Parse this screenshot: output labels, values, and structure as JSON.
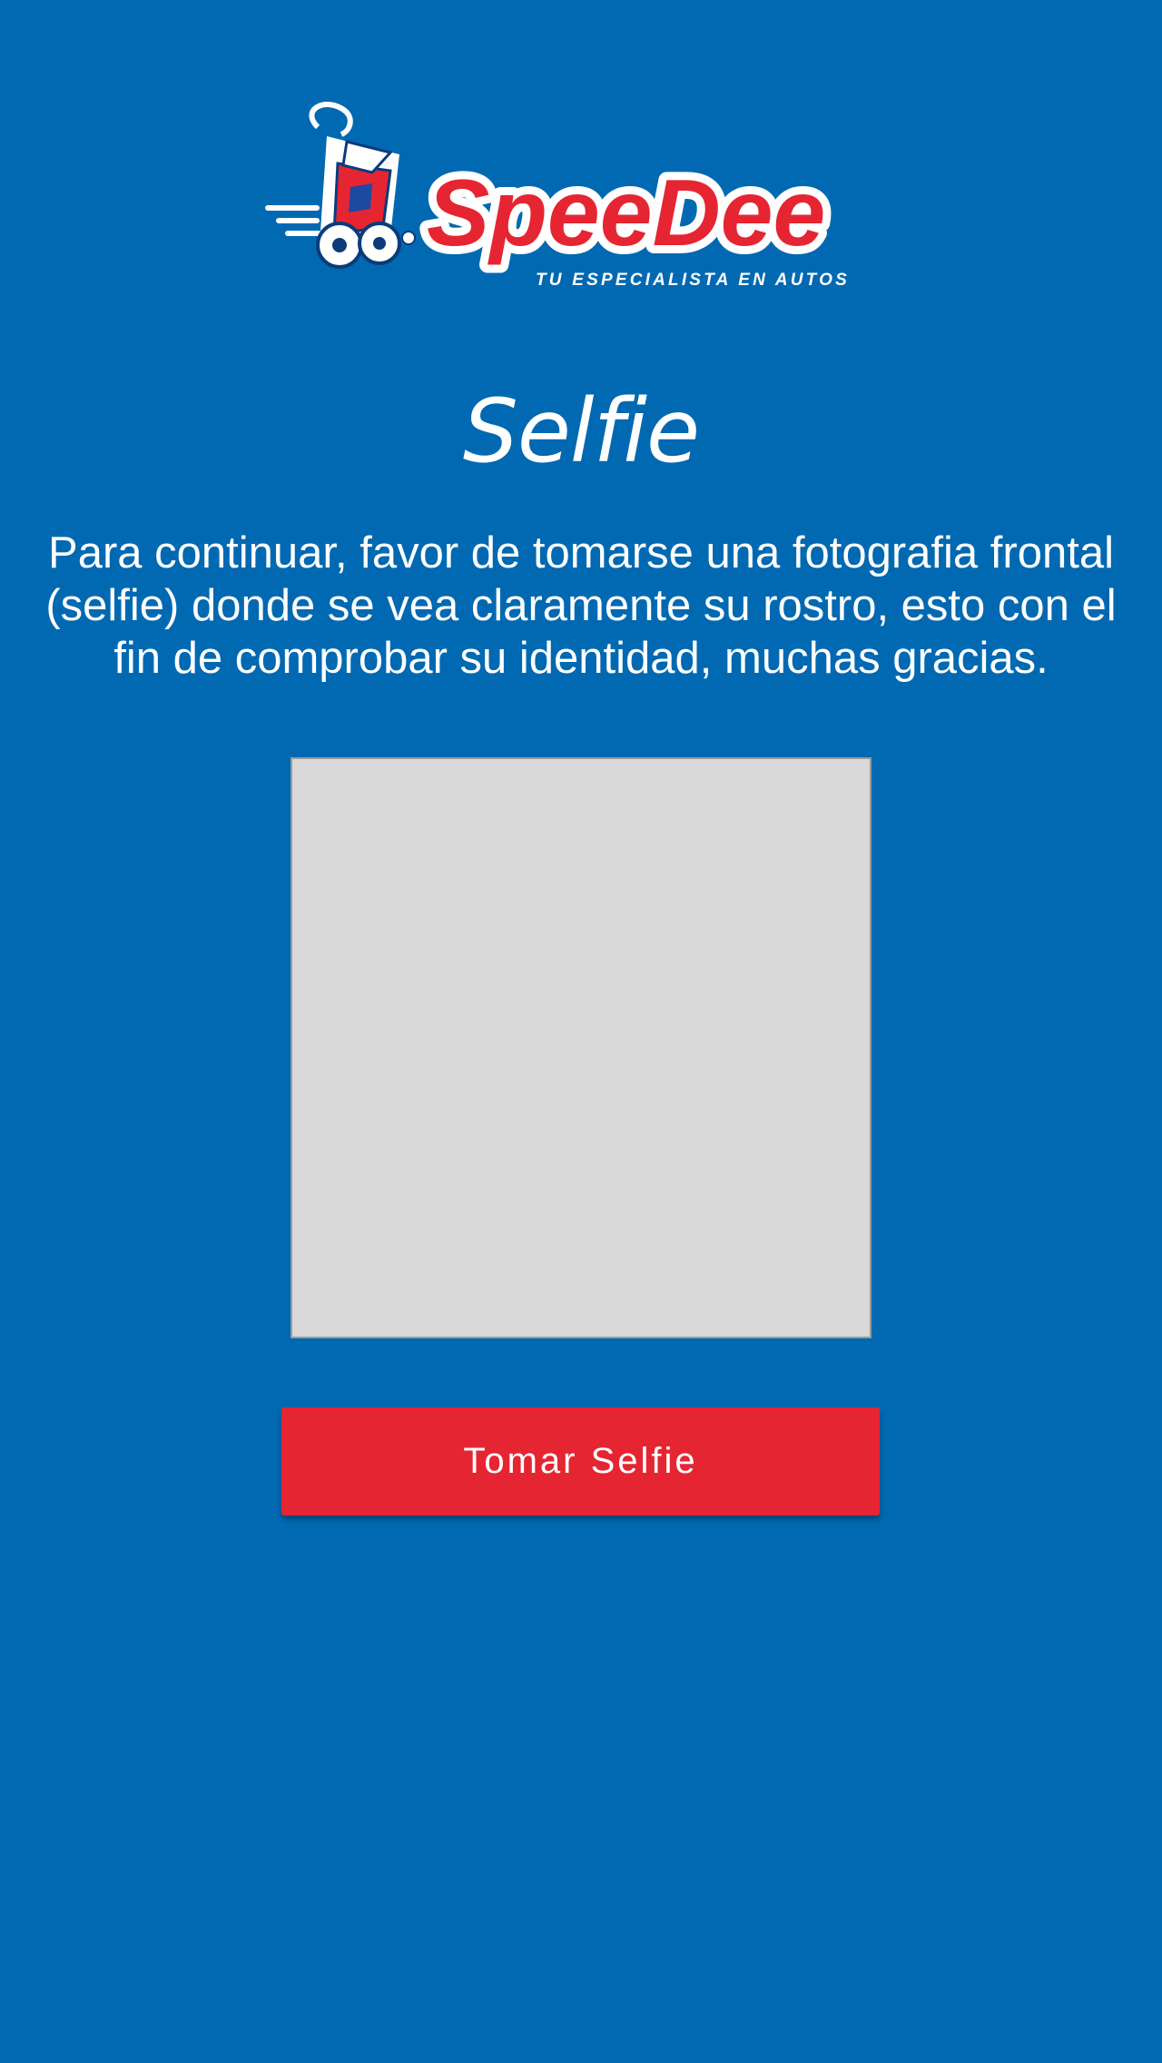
{
  "brand": {
    "name": "SpeeDee",
    "tagline": "TU ESPECIALISTA EN AUTOS",
    "logo_icon": "mascot-racer-icon",
    "colors": {
      "background": "#0169b2",
      "accent_red": "#e62532",
      "text": "#ffffff",
      "preview_fill": "#d9d9d9"
    }
  },
  "header": {
    "title": "Selfie"
  },
  "main": {
    "instructions": "Para continuar, favor de tomarse una fotografia frontal (selfie) donde se vea claramente su rostro, esto con el fin de comprobar su identidad, muchas gracias.",
    "take_selfie_label": "Tomar Selfie"
  }
}
